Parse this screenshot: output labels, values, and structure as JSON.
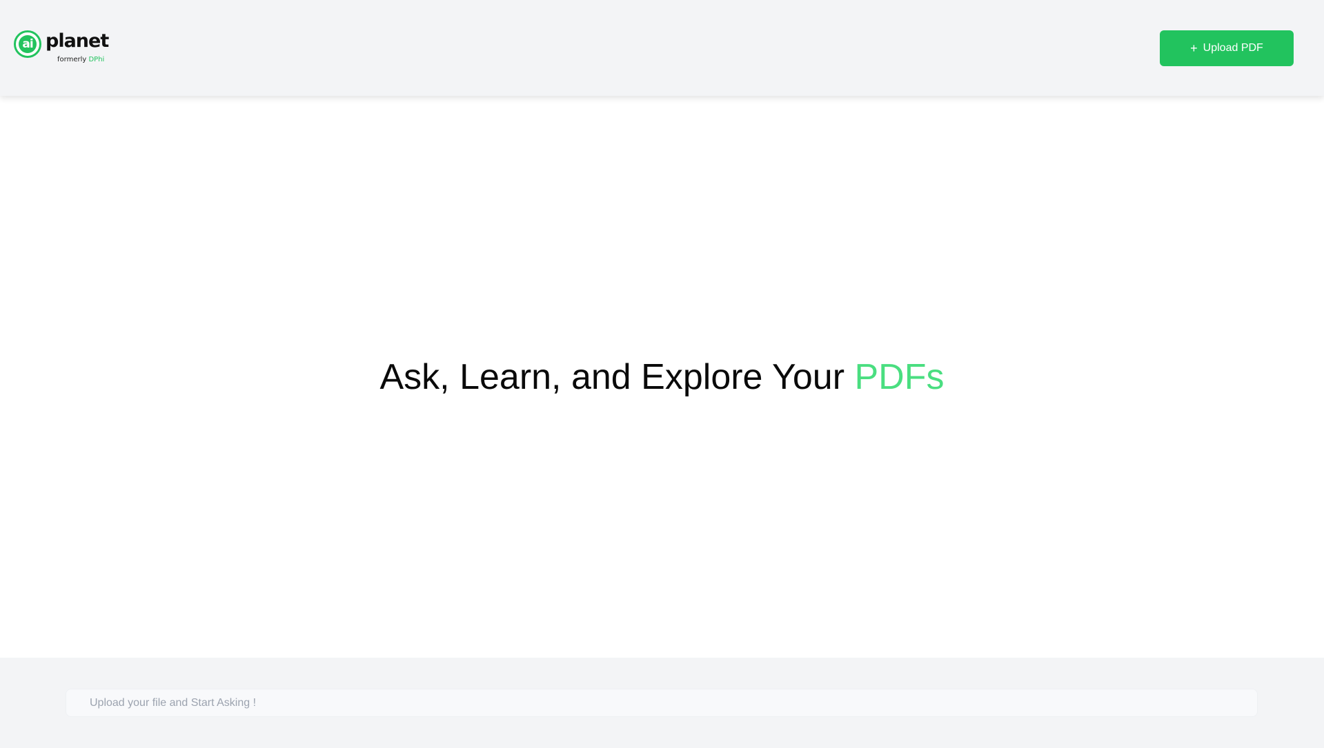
{
  "header": {
    "logo": {
      "badge_text": "ai",
      "word": "planet",
      "sub_prefix": "formerly",
      "sub_brand": "DPhi"
    },
    "upload_button": {
      "icon": "plus-icon",
      "icon_glyph": "+",
      "label": "Upload PDF"
    }
  },
  "main": {
    "headline": {
      "text": "Ask, Learn, and Explore Your",
      "highlight": "PDFs"
    }
  },
  "footer": {
    "question_input": {
      "placeholder": "Upload your file and Start Asking !",
      "value": ""
    }
  },
  "colors": {
    "brand_green": "#22c35e",
    "highlight_green": "#4ade80",
    "header_bg": "#f3f4f6"
  }
}
